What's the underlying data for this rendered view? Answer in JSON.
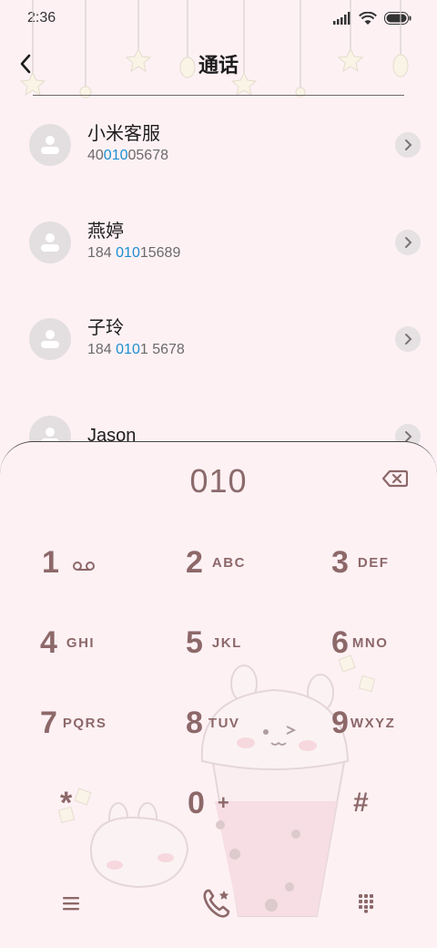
{
  "status_bar": {
    "time": "2:36"
  },
  "header": {
    "title": "通话"
  },
  "contacts": [
    {
      "name": "小米客服",
      "number_pre": "40",
      "number_match": "010",
      "number_post": "05678"
    },
    {
      "name": "燕婷",
      "number_pre": "184 ",
      "number_match": "010",
      "number_post": "15689"
    },
    {
      "name": "子玲",
      "number_pre": "184 ",
      "number_match": "010",
      "number_post": "1 5678"
    },
    {
      "name": "Jason",
      "number_pre": "",
      "number_match": "",
      "number_post": ""
    }
  ],
  "dialer": {
    "input": "010",
    "keys": [
      {
        "digit": "1",
        "letters": ""
      },
      {
        "digit": "2",
        "letters": "ABC"
      },
      {
        "digit": "3",
        "letters": "DEF"
      },
      {
        "digit": "4",
        "letters": "GHI"
      },
      {
        "digit": "5",
        "letters": "JKL"
      },
      {
        "digit": "6",
        "letters": "MNO"
      },
      {
        "digit": "7",
        "letters": "PQRS"
      },
      {
        "digit": "8",
        "letters": "TUV"
      },
      {
        "digit": "9",
        "letters": "WXYZ"
      },
      {
        "digit": "*",
        "letters": ""
      },
      {
        "digit": "0",
        "letters": "+"
      },
      {
        "digit": "#",
        "letters": ""
      }
    ]
  },
  "colors": {
    "accent": "#8d6869",
    "highlight": "#1d8fd0",
    "background": "#fdf1f4"
  },
  "icons": [
    "back-icon",
    "signal-icon",
    "wifi-icon",
    "battery-icon",
    "chevron-right-icon",
    "backspace-icon",
    "voicemail-icon",
    "menu-icon",
    "call-icon",
    "dialpad-icon"
  ]
}
